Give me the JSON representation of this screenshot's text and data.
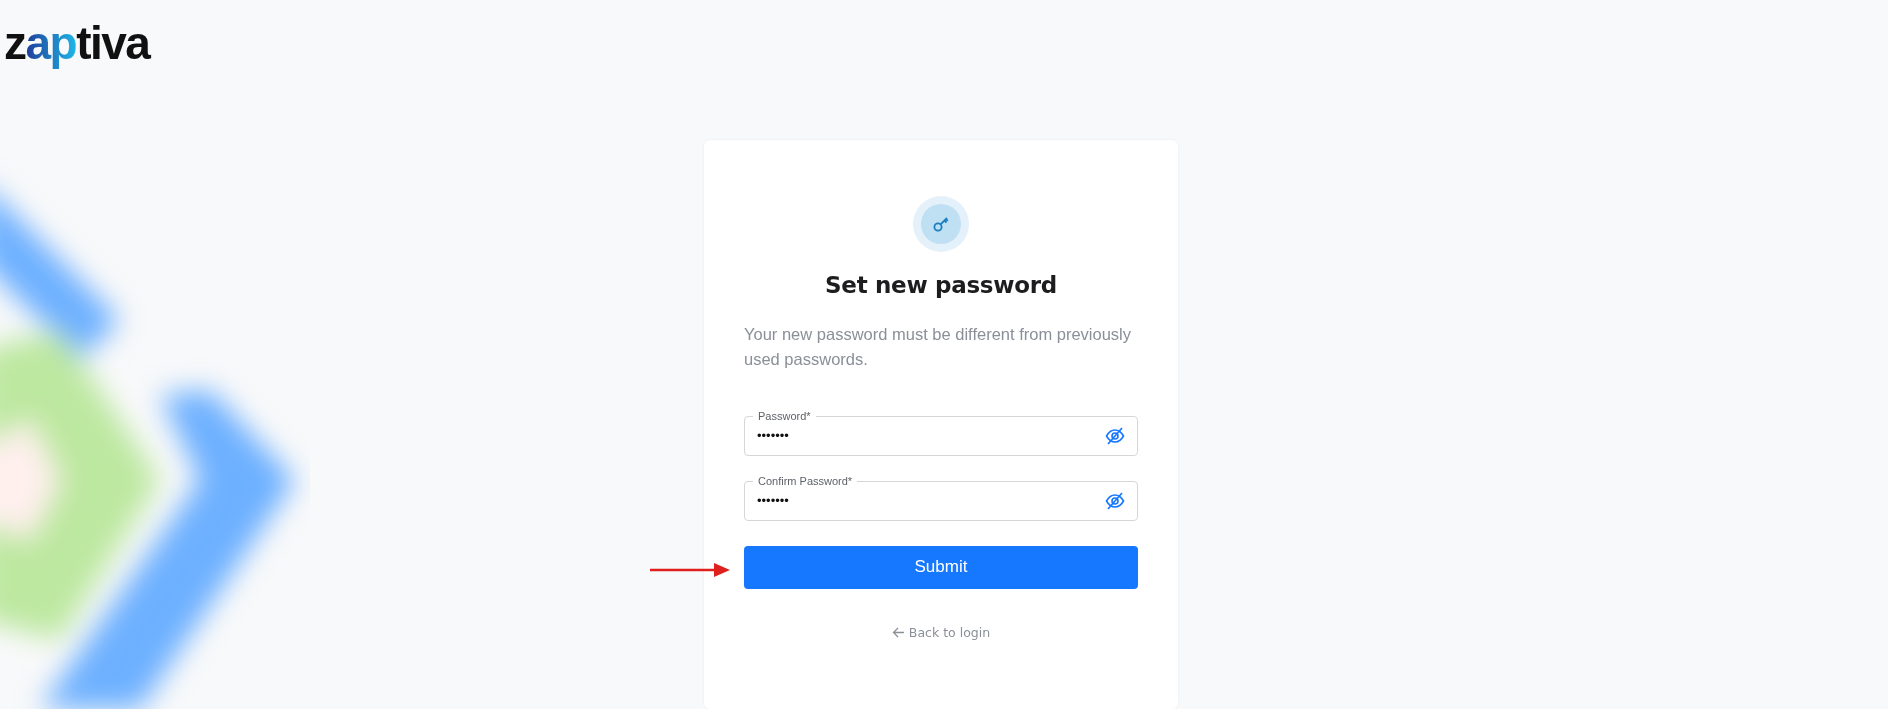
{
  "logo": {
    "parts": [
      {
        "text": "z",
        "accent": false
      },
      {
        "text": "ap",
        "accent": true
      },
      {
        "text": "tiva",
        "accent": false
      }
    ]
  },
  "card": {
    "title": "Set new password",
    "subtitle": "Your new password must be different from previously used passwords.",
    "fields": [
      {
        "label": "Password*",
        "value": "•••••••",
        "masked": true
      },
      {
        "label": "Confirm Password*",
        "value": "•••••••",
        "masked": true
      }
    ],
    "submit": "Submit",
    "back_link": "Back to login"
  }
}
